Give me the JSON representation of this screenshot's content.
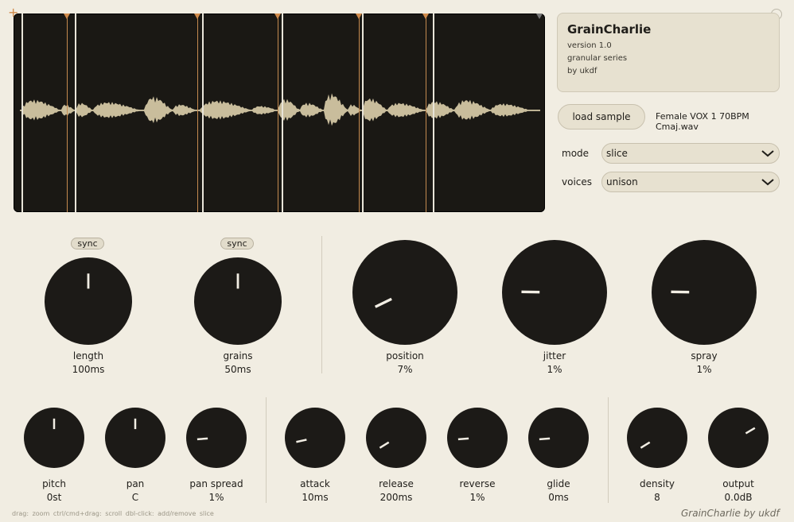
{
  "app": {
    "title": "GrainCharlie",
    "version": "version 1.0",
    "series": "granular series",
    "author": "by ukdf",
    "brand": "GrainCharlie by ukdf"
  },
  "sample": {
    "load_label": "load sample",
    "file_name": "Female VOX 1 70BPM Cmaj.wav"
  },
  "mode": {
    "label": "mode",
    "value": "slice"
  },
  "voices": {
    "label": "voices",
    "value": "unison"
  },
  "sync_label": "sync",
  "knobs_top": [
    {
      "label": "length",
      "value": "100ms",
      "level": 0.5
    },
    {
      "label": "grains",
      "value": "50ms",
      "level": 0.5
    },
    {
      "label": "position",
      "value": "7%",
      "level": 0.07
    },
    {
      "label": "jitter",
      "value": "1%",
      "level": 0.17
    },
    {
      "label": "spray",
      "value": "1%",
      "level": 0.17
    }
  ],
  "knobs_bottom": [
    {
      "label": "pitch",
      "value": "0st",
      "level": 0.5
    },
    {
      "label": "pan",
      "value": "C",
      "level": 0.5
    },
    {
      "label": "pan spread",
      "value": "1%",
      "level": 0.15
    },
    {
      "label": "attack",
      "value": "10ms",
      "level": 0.12
    },
    {
      "label": "release",
      "value": "200ms",
      "level": 0.05
    },
    {
      "label": "reverse",
      "value": "1%",
      "level": 0.15
    },
    {
      "label": "glide",
      "value": "0ms",
      "level": 0.15
    },
    {
      "label": "density",
      "value": "8",
      "level": 0.05
    },
    {
      "label": "output",
      "value": "0.0dB",
      "level": 0.72
    }
  ],
  "hint": "drag: zoom   ctrl/cmd+drag: scroll   dbl-click: add/remove slice",
  "colors": {
    "background": "#f1ede2",
    "waveform": "#c9bd9c",
    "marker": "#d08a4a",
    "knob": "#1c1a17"
  }
}
